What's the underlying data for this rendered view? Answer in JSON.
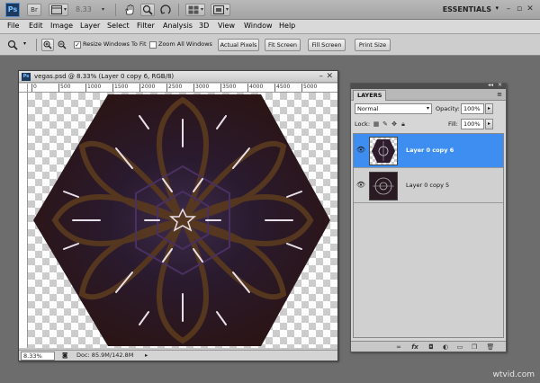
{
  "appbar": {
    "logo": "Ps",
    "br_label": "Br",
    "zoom_value": "8.33",
    "workspace": "ESSENTIALS",
    "icons": [
      "hand-icon",
      "zoom-icon",
      "rotate-view-icon",
      "arrange-documents-icon",
      "screen-mode-icon"
    ],
    "search_icon": "search-icon"
  },
  "menubar": {
    "items": [
      "File",
      "Edit",
      "Image",
      "Layer",
      "Select",
      "Filter",
      "Analysis",
      "3D",
      "View",
      "Window",
      "Help"
    ]
  },
  "options": {
    "resize_windows_label": "Resize Windows To Fit",
    "resize_windows_checked": true,
    "zoom_all_label": "Zoom All Windows",
    "zoom_all_checked": false,
    "buttons": [
      "Actual Pixels",
      "Fit Screen",
      "Fill Screen",
      "Print Size"
    ]
  },
  "document": {
    "title": "vegas.psd @ 8.33% (Layer 0 copy 6, RGB/8)",
    "ruler_marks": [
      "0",
      "500",
      "1000",
      "1500",
      "2000",
      "2500",
      "3000",
      "3500",
      "4000",
      "4500",
      "5000"
    ],
    "zoom_status": "8.33%",
    "doc_size": "Doc: 85.9M/142.8M"
  },
  "layers_panel": {
    "tab": "LAYERS",
    "blend_mode": "Normal",
    "opacity_label": "Opacity:",
    "opacity_value": "100%",
    "lock_label": "Lock:",
    "fill_label": "Fill:",
    "fill_value": "100%",
    "layers": [
      {
        "name": "Layer 0 copy 6",
        "selected": true,
        "visible": true
      },
      {
        "name": "Layer 0 copy 5",
        "selected": false,
        "visible": true
      }
    ]
  },
  "colors": {
    "accent": "#3d8ef0",
    "app_bg": "#6d6d6d"
  },
  "watermark": "wtvid.com"
}
